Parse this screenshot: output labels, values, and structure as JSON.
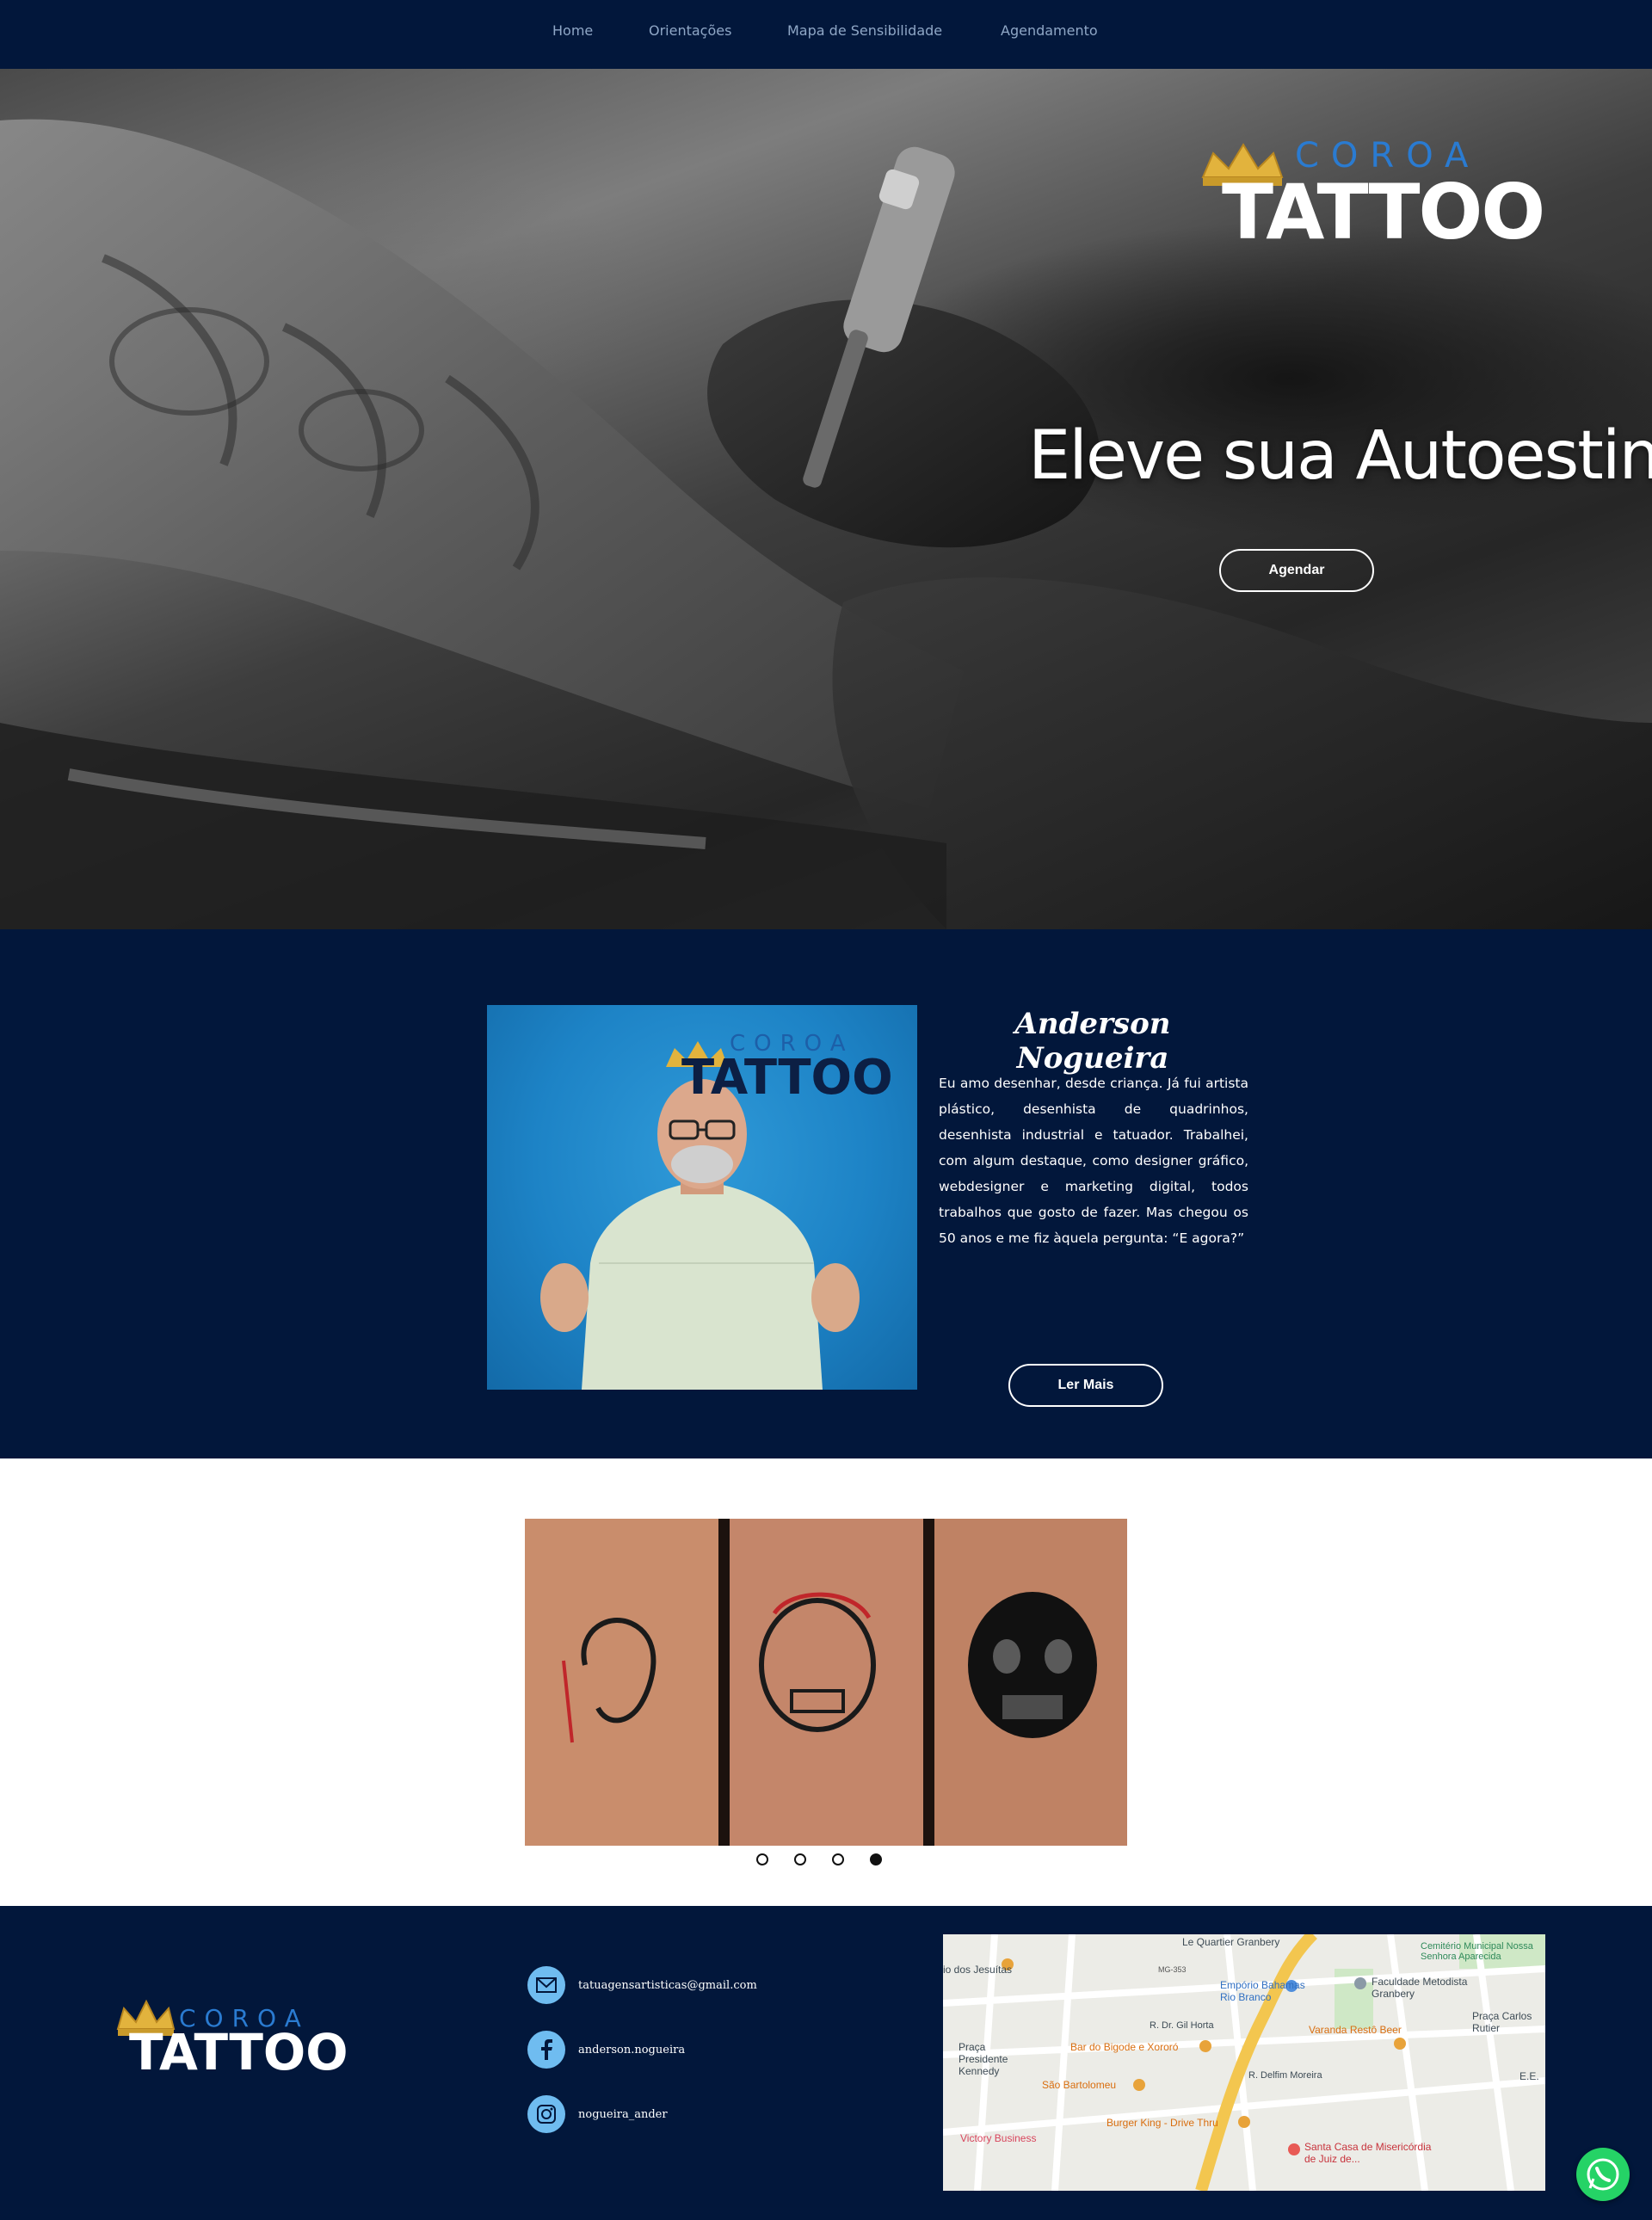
{
  "nav": {
    "items": [
      {
        "label": "Home"
      },
      {
        "label": "Orientações"
      },
      {
        "label": "Mapa de Sensibilidade"
      },
      {
        "label": "Agendamento"
      }
    ]
  },
  "brand": {
    "logo_top": "COROA",
    "logo_bottom": "TATTOO",
    "gold": "#e2b33d",
    "accent_blue": "#2a7bd1"
  },
  "hero": {
    "title": "Eleve sua Autoestima",
    "cta_label": "Agendar"
  },
  "about": {
    "name": "Anderson Nogueira",
    "bio": "Eu amo desenhar, desde criança. Já fui artista plástico, desenhista de quadrinhos, desenhista industrial e tatuador. Trabalhei, com algum destaque, como designer gráfico, webdesigner e marketing digital, todos trabalhos que gosto de fazer. Mas chegou os 50 anos e me fiz àquela pergunta: “E agora?”",
    "cta_label": "Ler Mais"
  },
  "gallery": {
    "slide_count": 4,
    "active_index": 3
  },
  "footer": {
    "contacts": [
      {
        "icon": "mail-icon",
        "label": "tatuagensartisticas@gmail.com"
      },
      {
        "icon": "facebook-icon",
        "label": "anderson.nogueira"
      },
      {
        "icon": "instagram-icon",
        "label": "nogueira_ander"
      }
    ],
    "map_labels": {
      "quartier": "Le Quartier Granbery",
      "cemiterio": "Cemitério Municipal Nossa Senhora Aparecida",
      "jesuitas": "io dos Jesuítas",
      "emporio": "Empório Bahamas Rio Branco",
      "faculdade": "Faculdade Metodista Granbery",
      "praca_carlos": "Praça Carlos Rutier",
      "gil_horta": "R. Dr. Gil Horta",
      "bar_bigode": "Bar do Bigode e Xororó",
      "varanda": "Varanda Restô Beer",
      "praca_presidente": "Praça Presidente Kennedy",
      "sao_bartolomeu": "São Bartolomeu",
      "delfim": "R. Delfim Moreira",
      "ee": "E.E.",
      "burger": "Burger King - Drive Thru",
      "victory": "Victory Business",
      "santa_casa": "Santa Casa de Misericórdia de Juiz de...",
      "mg353": "MG-353"
    }
  },
  "whatsapp": {
    "icon": "whatsapp-icon",
    "color": "#25d366"
  }
}
